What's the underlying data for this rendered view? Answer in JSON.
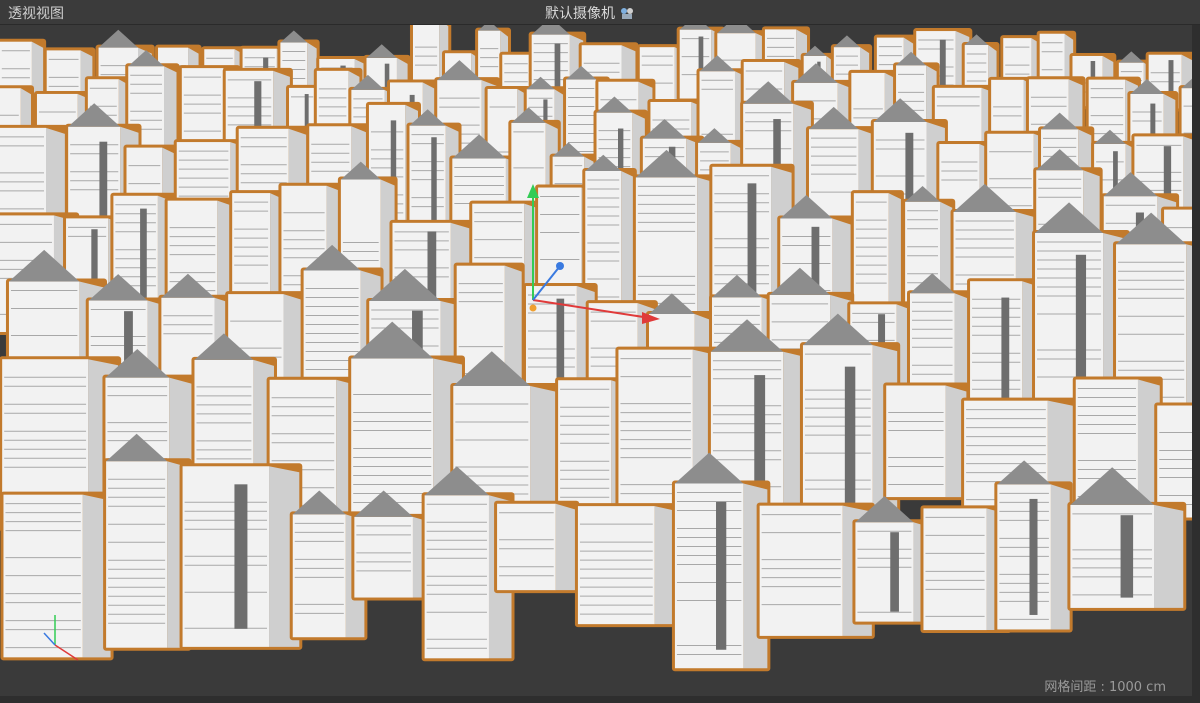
{
  "viewport": {
    "view_name": "透视视图",
    "camera_name": "默认摄像机",
    "grid_spacing": "网格间距 : 1000 cm"
  },
  "icons": {
    "camera": "camera-icon",
    "axis_gizmo": "axis-gizmo-icon",
    "move_manipulator": "move-manipulator-icon"
  },
  "colors": {
    "background": "#3a3a3a",
    "building": "#f2f2f2",
    "building_shade": "#8d8d8d",
    "selection_outline": "#c27a2c",
    "axis_x": "#e03a3a",
    "axis_y": "#33cc55",
    "axis_z": "#3a7ae0"
  }
}
